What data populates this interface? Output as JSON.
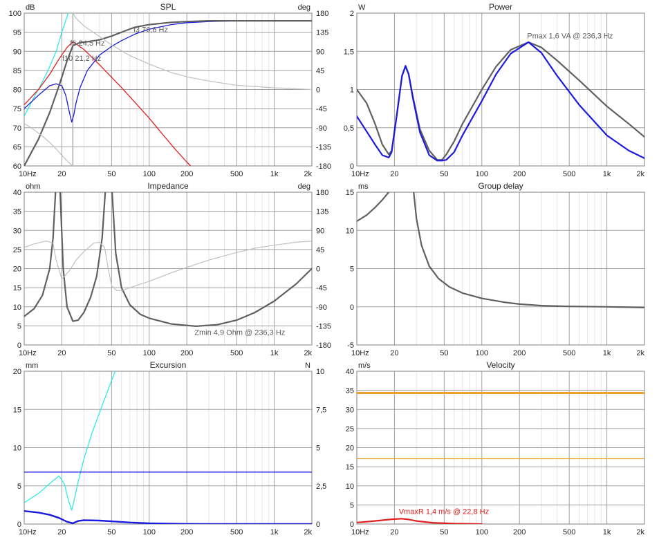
{
  "chart_data": [
    {
      "id": "spl",
      "type": "line",
      "title": "SPL",
      "left_unit": "dB",
      "right_unit": "deg",
      "xscale": "log",
      "xlim": [
        10,
        2000
      ],
      "ylim": [
        60,
        100
      ],
      "y2lim": [
        -180,
        180
      ],
      "x_tick_labels": [
        "10Hz",
        "20",
        "50",
        "100",
        "200",
        "500",
        "1k",
        "2k"
      ],
      "y_tick_labels": [
        "60",
        "65",
        "70",
        "75",
        "80",
        "85",
        "90",
        "95",
        "100"
      ],
      "y2_tick_labels": [
        "-180",
        "-135",
        "-90",
        "-45",
        "0",
        "45",
        "90",
        "135",
        "180"
      ],
      "grid": true,
      "markers": [
        {
          "x": 24.5,
          "color": "#aaaaaa"
        }
      ],
      "annotations": [
        {
          "text": "f6 24,5 Hz",
          "x": 24.5,
          "y": 91.5
        },
        {
          "text": "f10 21,2 Hz",
          "x": 21.2,
          "y": 87.5
        },
        {
          "text": "f3 76,6 Hz",
          "x": 76.6,
          "y": 95
        }
      ],
      "series": [
        {
          "color": "#30e8e8",
          "width": 1.3,
          "axis": "left",
          "x": [
            10,
            12,
            14,
            16,
            18,
            20,
            22,
            24
          ],
          "y": [
            73,
            78,
            82,
            86,
            90,
            95,
            99,
            103
          ]
        },
        {
          "color": "#e02020",
          "width": 1.3,
          "axis": "left",
          "x": [
            10,
            13,
            16,
            19,
            22,
            24.5,
            30,
            40,
            60,
            80,
            100,
            130,
            160,
            200,
            230
          ],
          "y": [
            76,
            80,
            84,
            88,
            91,
            92.5,
            90.5,
            86.5,
            80.5,
            76,
            72.5,
            68,
            64.5,
            61,
            59
          ]
        },
        {
          "color": "#1a1ae0",
          "width": 1.3,
          "axis": "left",
          "x": [
            10,
            13,
            16,
            18,
            20,
            21.5,
            23,
            24,
            25,
            26,
            28,
            32,
            40,
            50,
            60,
            76.6,
            100,
            150,
            200,
            300,
            500,
            1000,
            2000
          ],
          "y": [
            75,
            78.5,
            81,
            81.5,
            81,
            78.5,
            74,
            71.5,
            73.5,
            76.5,
            80.5,
            85,
            89,
            91.3,
            92.8,
            94.5,
            95.8,
            97,
            97.5,
            97.8,
            98,
            98,
            98
          ]
        },
        {
          "color": "#606060",
          "width": 2.2,
          "axis": "left",
          "x": [
            10,
            13,
            16,
            19,
            22,
            24.5,
            28,
            32,
            40,
            50,
            60,
            76.6,
            100,
            150,
            200,
            300,
            500,
            1000,
            2000
          ],
          "y": [
            60,
            67,
            74,
            81,
            87.5,
            91.5,
            92.3,
            92.5,
            93,
            94,
            95,
            96.3,
            97,
            97.6,
            97.8,
            98,
            98,
            98,
            98
          ]
        },
        {
          "color": "#c0c0c0",
          "width": 1.2,
          "axis": "right",
          "x": [
            10,
            12,
            14,
            16,
            18,
            20,
            22,
            24,
            24.5
          ],
          "y": [
            -80,
            -95,
            -110,
            -125,
            -140,
            -155,
            -168,
            -178,
            -180
          ]
        },
        {
          "color": "#c0c0c0",
          "width": 1.2,
          "axis": "right",
          "x": [
            24.5,
            26,
            30,
            40,
            50,
            70,
            100,
            150,
            200,
            300,
            500,
            1000,
            2000
          ],
          "y": [
            180,
            168,
            150,
            125,
            105,
            80,
            60,
            40,
            30,
            20,
            10,
            4,
            0
          ]
        }
      ]
    },
    {
      "id": "power",
      "type": "line",
      "title": "Power",
      "left_unit": "W",
      "xscale": "log",
      "xlim": [
        10,
        2000
      ],
      "ylim": [
        0,
        2
      ],
      "x_tick_labels": [
        "10Hz",
        "20",
        "50",
        "100",
        "200",
        "500",
        "1k",
        "2k"
      ],
      "y_tick_labels": [
        "0",
        "0,5",
        "1",
        "1,5",
        "2"
      ],
      "grid": true,
      "annotations": [
        {
          "text": "Pmax 1,6 VA  @ 236,3 Hz",
          "x": 236.3,
          "y": 1.67
        }
      ],
      "series": [
        {
          "color": "#606060",
          "width": 2.2,
          "x": [
            10,
            12,
            14,
            16,
            18,
            19,
            21,
            23,
            24.5,
            26,
            28,
            32,
            38,
            44,
            48,
            52,
            60,
            70,
            100,
            130,
            170,
            236.3,
            300,
            400,
            600,
            1000,
            1500,
            2000
          ],
          "y": [
            1.0,
            0.82,
            0.55,
            0.28,
            0.15,
            0.2,
            0.7,
            1.18,
            1.3,
            1.2,
            0.92,
            0.48,
            0.2,
            0.08,
            0.08,
            0.15,
            0.32,
            0.55,
            1.0,
            1.3,
            1.52,
            1.62,
            1.55,
            1.38,
            1.12,
            0.78,
            0.55,
            0.38
          ]
        },
        {
          "color": "#1a1ae0",
          "width": 2.2,
          "x": [
            10,
            12,
            14,
            16,
            18,
            19,
            21,
            23,
            24.5,
            26,
            28,
            32,
            38,
            44,
            48,
            52,
            60,
            70,
            100,
            130,
            170,
            236.3,
            300,
            400,
            600,
            1000,
            1500,
            2000
          ],
          "y": [
            0.65,
            0.45,
            0.28,
            0.14,
            0.11,
            0.18,
            0.7,
            1.18,
            1.31,
            1.2,
            0.9,
            0.44,
            0.14,
            0.07,
            0.07,
            0.08,
            0.18,
            0.4,
            0.85,
            1.2,
            1.47,
            1.62,
            1.48,
            1.18,
            0.8,
            0.4,
            0.2,
            0.1
          ]
        }
      ]
    },
    {
      "id": "impedance",
      "type": "line",
      "title": "Impedance",
      "left_unit": "ohm",
      "right_unit": "deg",
      "xscale": "log",
      "xlim": [
        10,
        2000
      ],
      "ylim": [
        0,
        40
      ],
      "y2lim": [
        -180,
        180
      ],
      "x_tick_labels": [
        "10Hz",
        "20",
        "50",
        "100",
        "200",
        "500",
        "1k",
        "2k"
      ],
      "y_tick_labels": [
        "0",
        "5",
        "10",
        "15",
        "20",
        "25",
        "30",
        "35",
        "40"
      ],
      "y2_tick_labels": [
        "-180",
        "-135",
        "-90",
        "-45",
        "0",
        "45",
        "90",
        "135",
        "180"
      ],
      "grid": true,
      "annotations": [
        {
          "text": "Zmin 4,9 Ohm @ 236,3 Hz",
          "x": 236.3,
          "y": 2.6
        }
      ],
      "series": [
        {
          "color": "#606060",
          "width": 2.2,
          "x": [
            10,
            12,
            14,
            16,
            17,
            17.8
          ],
          "y": [
            7.5,
            9.5,
            13,
            20,
            28,
            40
          ]
        },
        {
          "color": "#606060",
          "width": 2.2,
          "x": [
            19.4,
            20.5,
            22,
            24.5,
            27,
            30,
            34,
            38,
            42,
            44.5
          ],
          "y": [
            40,
            20,
            10,
            6.2,
            6.5,
            8.5,
            12.5,
            18,
            28,
            40
          ]
        },
        {
          "color": "#606060",
          "width": 2.2,
          "x": [
            50.5,
            54,
            60,
            70,
            85,
            100,
            150,
            236.3,
            350,
            500,
            700,
            1000,
            1500,
            2000
          ],
          "y": [
            40,
            24,
            15,
            10.5,
            8,
            7,
            5.5,
            4.9,
            5.3,
            6.5,
            8.5,
            11.5,
            16,
            20
          ]
        },
        {
          "color": "#c0c0c0",
          "width": 1.2,
          "axis": "right",
          "x": [
            10,
            12,
            15,
            17,
            18,
            20,
            23,
            26,
            30,
            36,
            40,
            44,
            47,
            50,
            55,
            60,
            70,
            100,
            150,
            236.3,
            300,
            500,
            700,
            1000,
            1500,
            2000
          ],
          "y": [
            50,
            58,
            65,
            60,
            20,
            -25,
            -5,
            20,
            40,
            60,
            62,
            50,
            0,
            -40,
            -52,
            -52,
            -45,
            -30,
            -10,
            10,
            20,
            38,
            48,
            55,
            62,
            65
          ]
        }
      ]
    },
    {
      "id": "group_delay",
      "type": "line",
      "title": "Group delay",
      "left_unit": "ms",
      "xscale": "log",
      "xlim": [
        10,
        2000
      ],
      "ylim": [
        -5,
        15
      ],
      "x_tick_labels": [
        "10Hz",
        "20",
        "50",
        "100",
        "200",
        "500",
        "1k",
        "2k"
      ],
      "y_tick_labels": [
        "-5",
        "0",
        "5",
        "10",
        "15"
      ],
      "grid": true,
      "series": [
        {
          "color": "#606060",
          "width": 2.2,
          "x": [
            10,
            12,
            14,
            16,
            18,
            20
          ],
          "y": [
            11.2,
            12,
            13,
            14,
            15,
            16
          ]
        },
        {
          "color": "#606060",
          "width": 2.2,
          "x": [
            28.5,
            30,
            33,
            38,
            45,
            55,
            70,
            100,
            150,
            200,
            300,
            500,
            1000,
            2000
          ],
          "y": [
            15,
            11.5,
            8,
            5.3,
            3.7,
            2.6,
            1.8,
            1.1,
            0.6,
            0.35,
            0.15,
            0.05,
            0,
            -0.1
          ]
        }
      ]
    },
    {
      "id": "excursion",
      "type": "line",
      "title": "Excursion",
      "left_unit": "mm",
      "right_unit": "N",
      "xscale": "log",
      "xlim": [
        10,
        2000
      ],
      "ylim": [
        0,
        20
      ],
      "y2lim": [
        0,
        10
      ],
      "x_tick_labels": [
        "10Hz",
        "20",
        "50",
        "100",
        "200",
        "500",
        "1k",
        "2k"
      ],
      "y_tick_labels": [
        "0",
        "5",
        "10",
        "15",
        "20"
      ],
      "y2_tick_labels": [
        "0",
        "2,5",
        "5",
        "7,5",
        "10"
      ],
      "grid": true,
      "series": [
        {
          "color": "#30e8e8",
          "width": 1.3,
          "x": [
            10,
            13,
            16,
            19,
            21,
            22.5,
            24,
            25,
            27,
            30,
            35,
            42,
            50,
            55
          ],
          "y": [
            2.8,
            4,
            5.3,
            6.3,
            5.2,
            3.2,
            1.8,
            3,
            5.5,
            8.5,
            12,
            15.5,
            18.8,
            20.5
          ]
        },
        {
          "color": "#1a1ae0",
          "width": 1.3,
          "x": [
            10,
            2000
          ],
          "y": [
            6.8,
            6.8
          ]
        },
        {
          "color": "#1a1ae0",
          "width": 2.4,
          "x": [
            10,
            13,
            16,
            19,
            22,
            24.5,
            27,
            30,
            40,
            50,
            70,
            100,
            150,
            200,
            300,
            500,
            1000,
            2000
          ],
          "y": [
            1.7,
            1.5,
            1.2,
            0.8,
            0.3,
            0.1,
            0.4,
            0.5,
            0.45,
            0.35,
            0.2,
            0.1,
            0.05,
            0.02,
            0,
            0,
            0,
            0
          ]
        }
      ]
    },
    {
      "id": "velocity",
      "type": "line",
      "title": "Velocity",
      "left_unit": "m/s",
      "xscale": "log",
      "xlim": [
        10,
        2000
      ],
      "ylim": [
        0,
        40
      ],
      "x_tick_labels": [
        "10Hz",
        "20",
        "50",
        "100",
        "200",
        "500",
        "1k",
        "2k"
      ],
      "y_tick_labels": [
        "0",
        "5",
        "10",
        "15",
        "20",
        "25",
        "30",
        "35",
        "40"
      ],
      "grid": true,
      "annotations": [
        {
          "text": "VmaxR 1,4 m/s @ 22,8 Hz",
          "x": 22.8,
          "y": 2.6,
          "color": "#e02020"
        }
      ],
      "series": [
        {
          "color": "#f0a030",
          "width": 1.3,
          "x": [
            10,
            2000
          ],
          "y": [
            17.1,
            17.1
          ]
        },
        {
          "color": "#f0a030",
          "width": 3,
          "x": [
            10,
            2000
          ],
          "y": [
            34.3,
            34.3
          ]
        },
        {
          "color": "#e02020",
          "width": 2.2,
          "x": [
            10,
            13,
            16,
            19,
            22.8,
            26,
            30,
            40,
            60,
            100
          ],
          "y": [
            0.4,
            0.7,
            1.0,
            1.25,
            1.4,
            1.2,
            0.8,
            0.35,
            0.1,
            0
          ]
        }
      ]
    }
  ]
}
